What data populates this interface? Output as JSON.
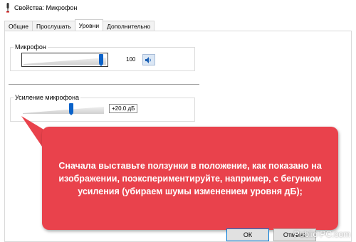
{
  "window": {
    "title": "Свойства: Микрофон"
  },
  "tabs": [
    {
      "label": "Общие",
      "active": false
    },
    {
      "label": "Прослушать",
      "active": false
    },
    {
      "label": "Уровни",
      "active": true
    },
    {
      "label": "Дополнительно",
      "active": false
    }
  ],
  "microphone": {
    "label": "Микрофон",
    "value": "100",
    "level_fraction": 0.95,
    "speaker_icon": "speaker-icon"
  },
  "boost": {
    "label": "Усиление микрофона",
    "value": "+20.0 дБ",
    "level_fraction": 0.6
  },
  "callout": {
    "text": "Сначала выставьте ползунки в положение, как показано на изображении, поэкспериментируйте, например, с бегунком усиления (убираем шумы изменением уровня дБ);",
    "color": "#e9424c"
  },
  "buttons": {
    "ok": "ОК",
    "cancel": "Отмена"
  },
  "watermark": "Public-PC.com",
  "colors": {
    "accent": "#0a62c9"
  }
}
